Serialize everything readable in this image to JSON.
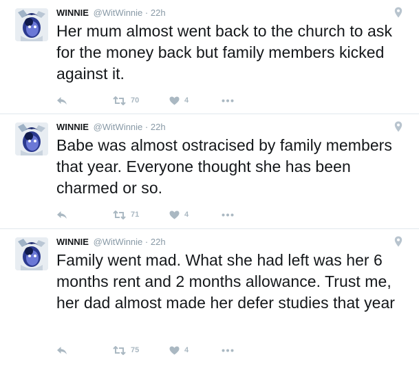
{
  "colors": {
    "text": "#14171a",
    "meta": "#8899a6",
    "action": "#aab8c2",
    "divider": "#e1e8ed"
  },
  "tweets": [
    {
      "name": "WINNIE",
      "handle": "@WitWinnie",
      "separator": "·",
      "time": "22h",
      "text": "Her mum almost went back to the church to ask for the money back but family members kicked against it.",
      "retweets": "70",
      "likes": "4"
    },
    {
      "name": "WINNIE",
      "handle": "@WitWinnie",
      "separator": "·",
      "time": "22h",
      "text": "Babe was almost ostracised by family members that year. Everyone thought she has been charmed or so.",
      "retweets": "71",
      "likes": "4"
    },
    {
      "name": "WINNIE",
      "handle": "@WitWinnie",
      "separator": "·",
      "time": "22h",
      "text": "Family went mad. What she had left was her 6 months rent and 2 months allowance. Trust me, her dad almost made her defer studies that year",
      "retweets": "75",
      "likes": "4"
    }
  ],
  "icons": {
    "avatar": "avatar-image",
    "location": "location-pin-icon",
    "reply": "reply-icon",
    "retweet": "retweet-icon",
    "like": "heart-icon",
    "more": "more-dots-icon"
  }
}
